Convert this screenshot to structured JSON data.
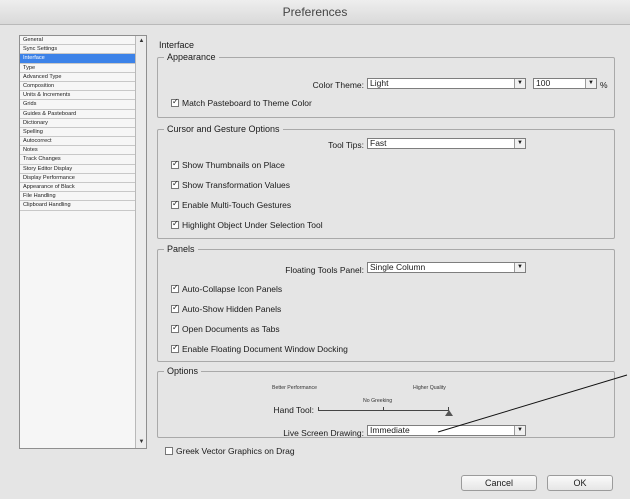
{
  "window": {
    "title": "Preferences"
  },
  "sidebar": {
    "items": [
      {
        "label": "General"
      },
      {
        "label": "Sync Settings"
      },
      {
        "label": "Interface",
        "selected": true
      },
      {
        "label": "Type"
      },
      {
        "label": "Advanced Type"
      },
      {
        "label": "Composition"
      },
      {
        "label": "Units & Increments"
      },
      {
        "label": "Grids"
      },
      {
        "label": "Guides & Pasteboard"
      },
      {
        "label": "Dictionary"
      },
      {
        "label": "Spelling"
      },
      {
        "label": "Autocorrect"
      },
      {
        "label": "Notes"
      },
      {
        "label": "Track Changes"
      },
      {
        "label": "Story Editor Display"
      },
      {
        "label": "Display Performance"
      },
      {
        "label": "Appearance of Black"
      },
      {
        "label": "File Handling"
      },
      {
        "label": "Clipboard Handling"
      }
    ],
    "scroll_up": "▲",
    "scroll_down": "▼"
  },
  "main": {
    "title": "Interface",
    "appearance": {
      "legend": "Appearance",
      "color_theme_label": "Color Theme:",
      "color_theme_value": "Light",
      "zoom_value": "100",
      "zoom_unit": "%",
      "match_pasteboard": "Match Pasteboard to Theme Color"
    },
    "cursor": {
      "legend": "Cursor and Gesture Options",
      "tool_tips_label": "Tool Tips:",
      "tool_tips_value": "Fast",
      "show_thumbnails": "Show Thumbnails on Place",
      "show_transformation": "Show Transformation Values",
      "multi_touch": "Enable Multi-Touch Gestures",
      "highlight_object": "Highlight Object Under Selection Tool"
    },
    "panels": {
      "legend": "Panels",
      "floating_label": "Floating Tools Panel:",
      "floating_value": "Single Column",
      "auto_collapse": "Auto-Collapse Icon Panels",
      "auto_show": "Auto-Show Hidden Panels",
      "open_tabs": "Open Documents as Tabs",
      "enable_docking": "Enable Floating Document Window Docking"
    },
    "options": {
      "legend": "Options",
      "better_performance": "Better Performance",
      "higher_quality": "Higher Quality",
      "no_greeking": "No Greeking",
      "hand_tool_label": "Hand Tool:",
      "hand_tool_level": 1.0,
      "live_drawing_label": "Live Screen Drawing:",
      "live_drawing_value": "Immediate"
    },
    "greek_vector": "Greek Vector Graphics on Drag"
  },
  "footer": {
    "cancel": "Cancel",
    "ok": "OK"
  },
  "icons": {
    "dropdown": "▼",
    "checkmark": "✓"
  },
  "colors": {
    "selection": "#3c82e8"
  }
}
